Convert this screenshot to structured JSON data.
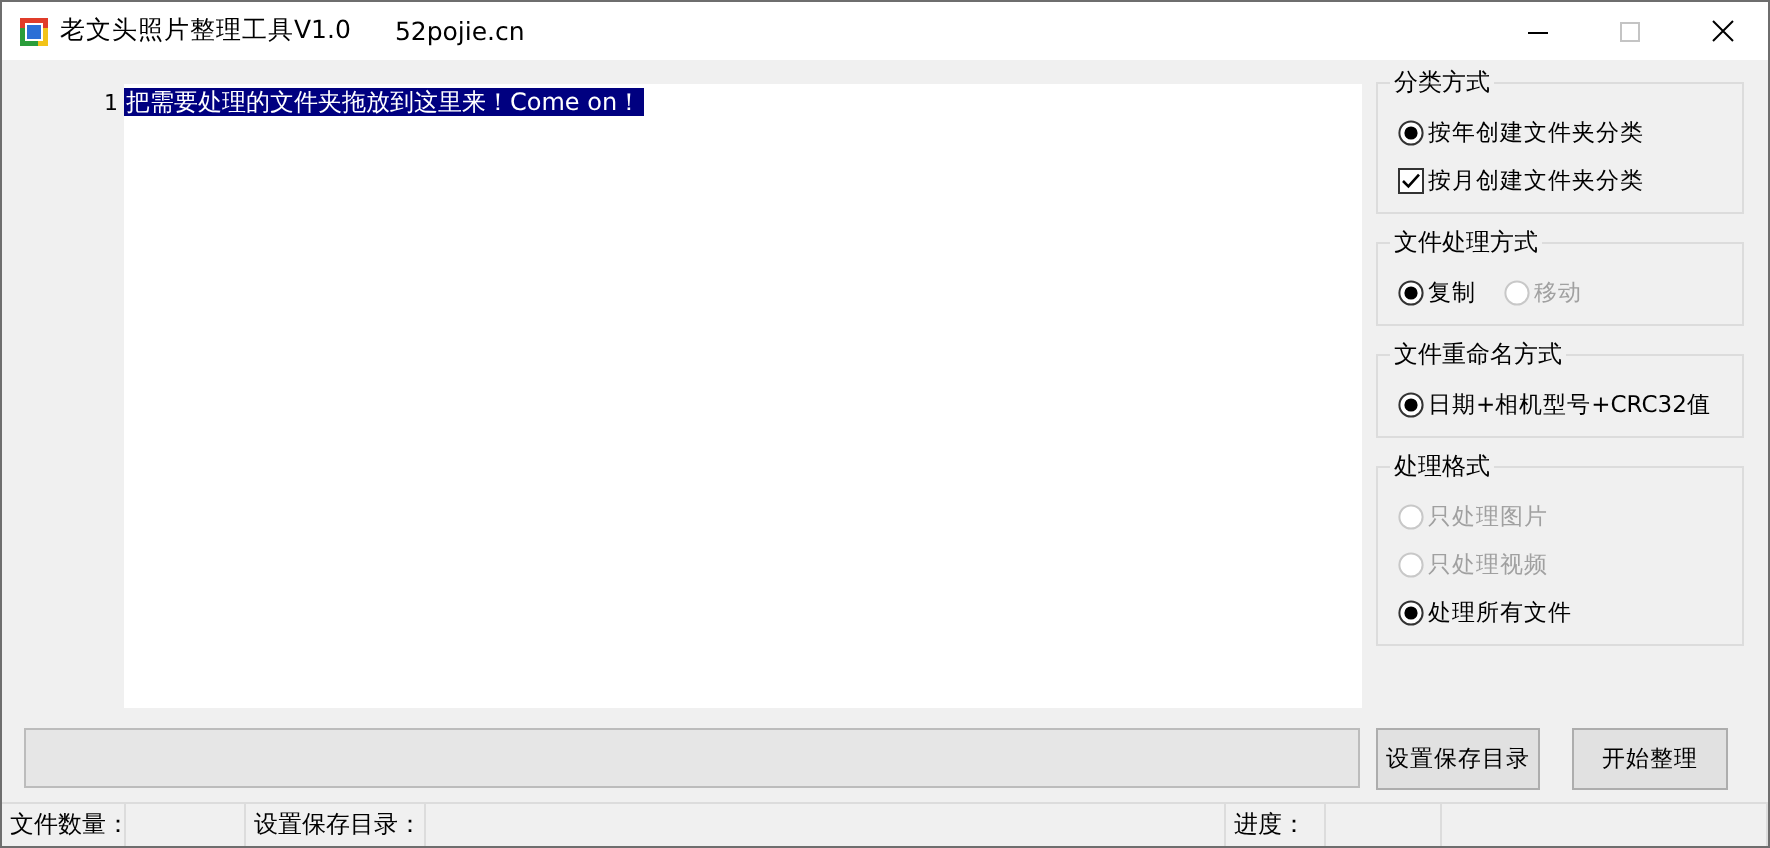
{
  "window": {
    "title": "老文头照片整理工具V1.0",
    "subtitle": "52pojie.cn",
    "maximize_disabled": true
  },
  "editor": {
    "line_number": "1",
    "text": "把需要处理的文件夹拖放到这里来！Come on！",
    "selected": true
  },
  "groups": [
    {
      "title": "分类方式",
      "kind": "column",
      "options": [
        {
          "kind": "radio",
          "label": "按年创建文件夹分类",
          "selected": true,
          "disabled": false
        },
        {
          "kind": "checkbox",
          "label": "按月创建文件夹分类",
          "checked": true,
          "disabled": false
        }
      ]
    },
    {
      "title": "文件处理方式",
      "kind": "row",
      "options": [
        {
          "kind": "radio",
          "label": "复制",
          "selected": true,
          "disabled": false
        },
        {
          "kind": "radio",
          "label": "移动",
          "selected": false,
          "disabled": true
        }
      ]
    },
    {
      "title": "文件重命名方式",
      "kind": "column",
      "options": [
        {
          "kind": "radio",
          "label": "日期+相机型号+CRC32值",
          "selected": true,
          "disabled": false
        }
      ]
    },
    {
      "title": "处理格式",
      "kind": "column",
      "options": [
        {
          "kind": "radio",
          "label": "只处理图片",
          "selected": false,
          "disabled": true
        },
        {
          "kind": "radio",
          "label": "只处理视频",
          "selected": false,
          "disabled": true
        },
        {
          "kind": "radio",
          "label": "处理所有文件",
          "selected": true,
          "disabled": false
        }
      ]
    }
  ],
  "progress": {
    "level": 0
  },
  "buttons": [
    "设置保存目录",
    "开始整理"
  ],
  "status_bar": [
    "文件数量：",
    "设置保存目录：",
    "进度："
  ]
}
